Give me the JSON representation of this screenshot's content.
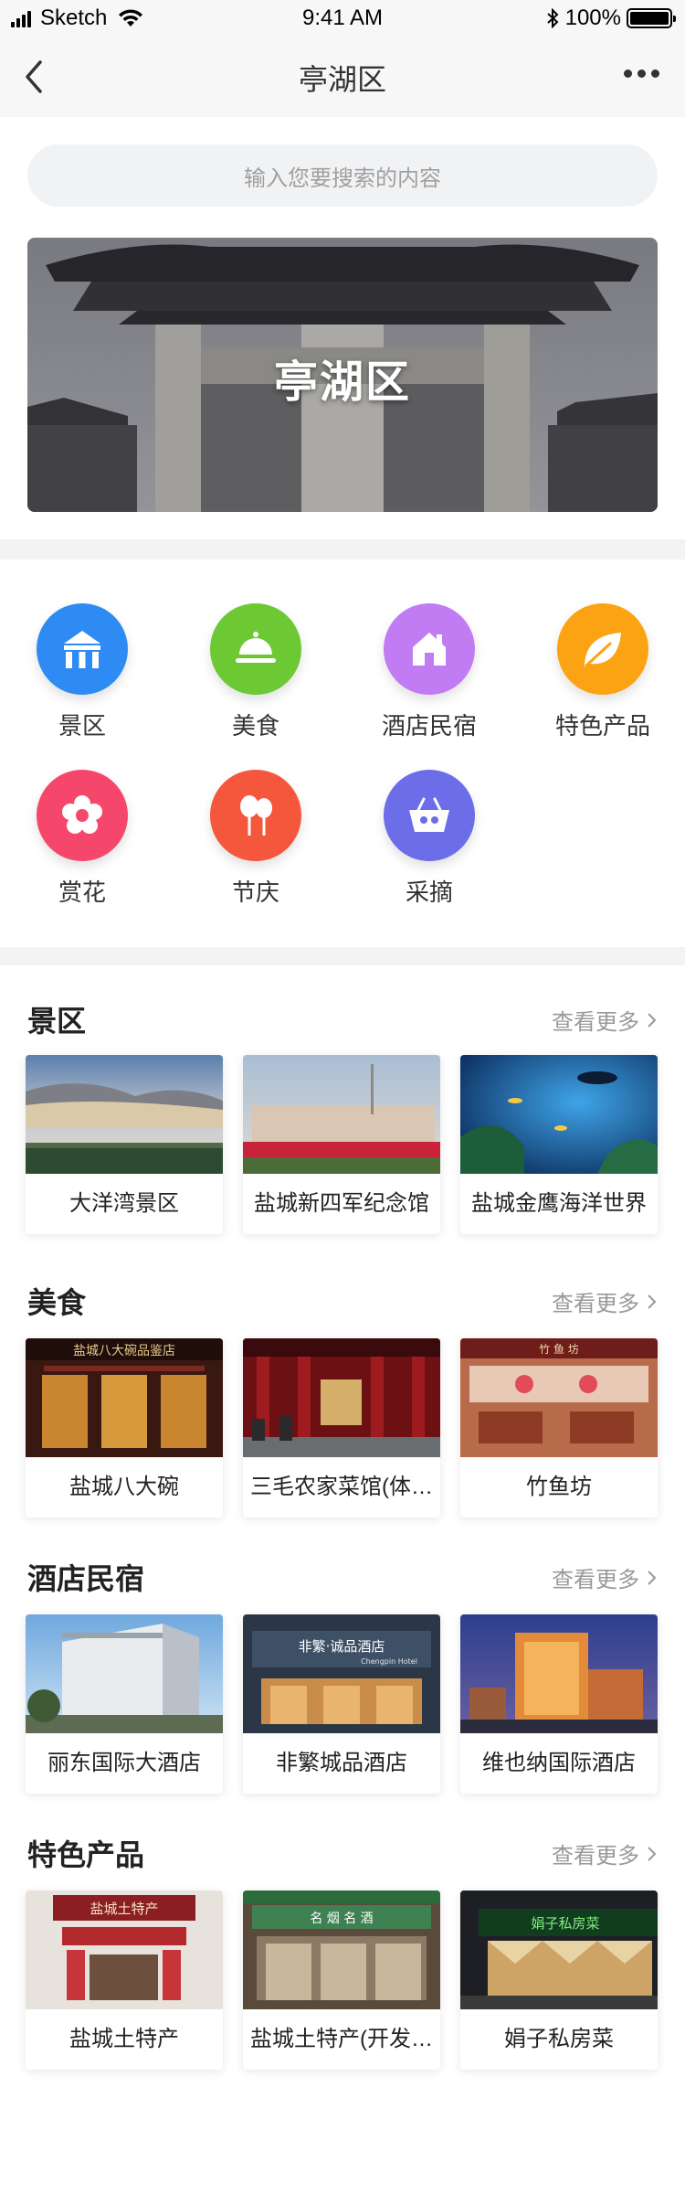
{
  "status": {
    "carrier": "Sketch",
    "time": "9:41 AM",
    "battery": "100%"
  },
  "nav": {
    "title": "亭湖区"
  },
  "search": {
    "placeholder": "输入您要搜索的内容"
  },
  "banner": {
    "title": "亭湖区"
  },
  "categories": [
    {
      "label": "景区",
      "icon": "gate-icon",
      "color": "#2e8bf3"
    },
    {
      "label": "美食",
      "icon": "dish-icon",
      "color": "#6cc934"
    },
    {
      "label": "酒店民宿",
      "icon": "house-icon",
      "color": "#c17cf4"
    },
    {
      "label": "特色产品",
      "icon": "leaf-icon",
      "color": "#fba313"
    },
    {
      "label": "赏花",
      "icon": "flower-icon",
      "color": "#f5476b"
    },
    {
      "label": "节庆",
      "icon": "balloon-icon",
      "color": "#f5573c"
    },
    {
      "label": "采摘",
      "icon": "basket-icon",
      "color": "#6b6de9"
    }
  ],
  "more_label": "查看更多",
  "sections": [
    {
      "title": "景区",
      "items": [
        "大洋湾景区",
        "盐城新四军纪念馆",
        "盐城金鹰海洋世界"
      ]
    },
    {
      "title": "美食",
      "items": [
        "盐城八大碗",
        "三毛农家菜馆(体育馆店)",
        "竹鱼坊"
      ]
    },
    {
      "title": "酒店民宿",
      "items": [
        "丽东国际大酒店",
        "非繁城品酒店",
        "维也纳国际酒店"
      ]
    },
    {
      "title": "特色产品",
      "items": [
        "盐城土特产",
        "盐城土特产(开发区店)",
        "娟子私房菜"
      ]
    }
  ],
  "photo_text": {
    "restaurant_sign": "盐城八大碗品鉴店",
    "yuzhu_sign": "竹 鱼 坊",
    "hotel_sign": "非繁·诚品酒店",
    "hotel_sign_en": "Chengpin Hotel",
    "shop_sign": "盐城土特产",
    "shop_sign2": "名 烟 名 酒",
    "juanzi_sign": "娟子私房菜"
  }
}
